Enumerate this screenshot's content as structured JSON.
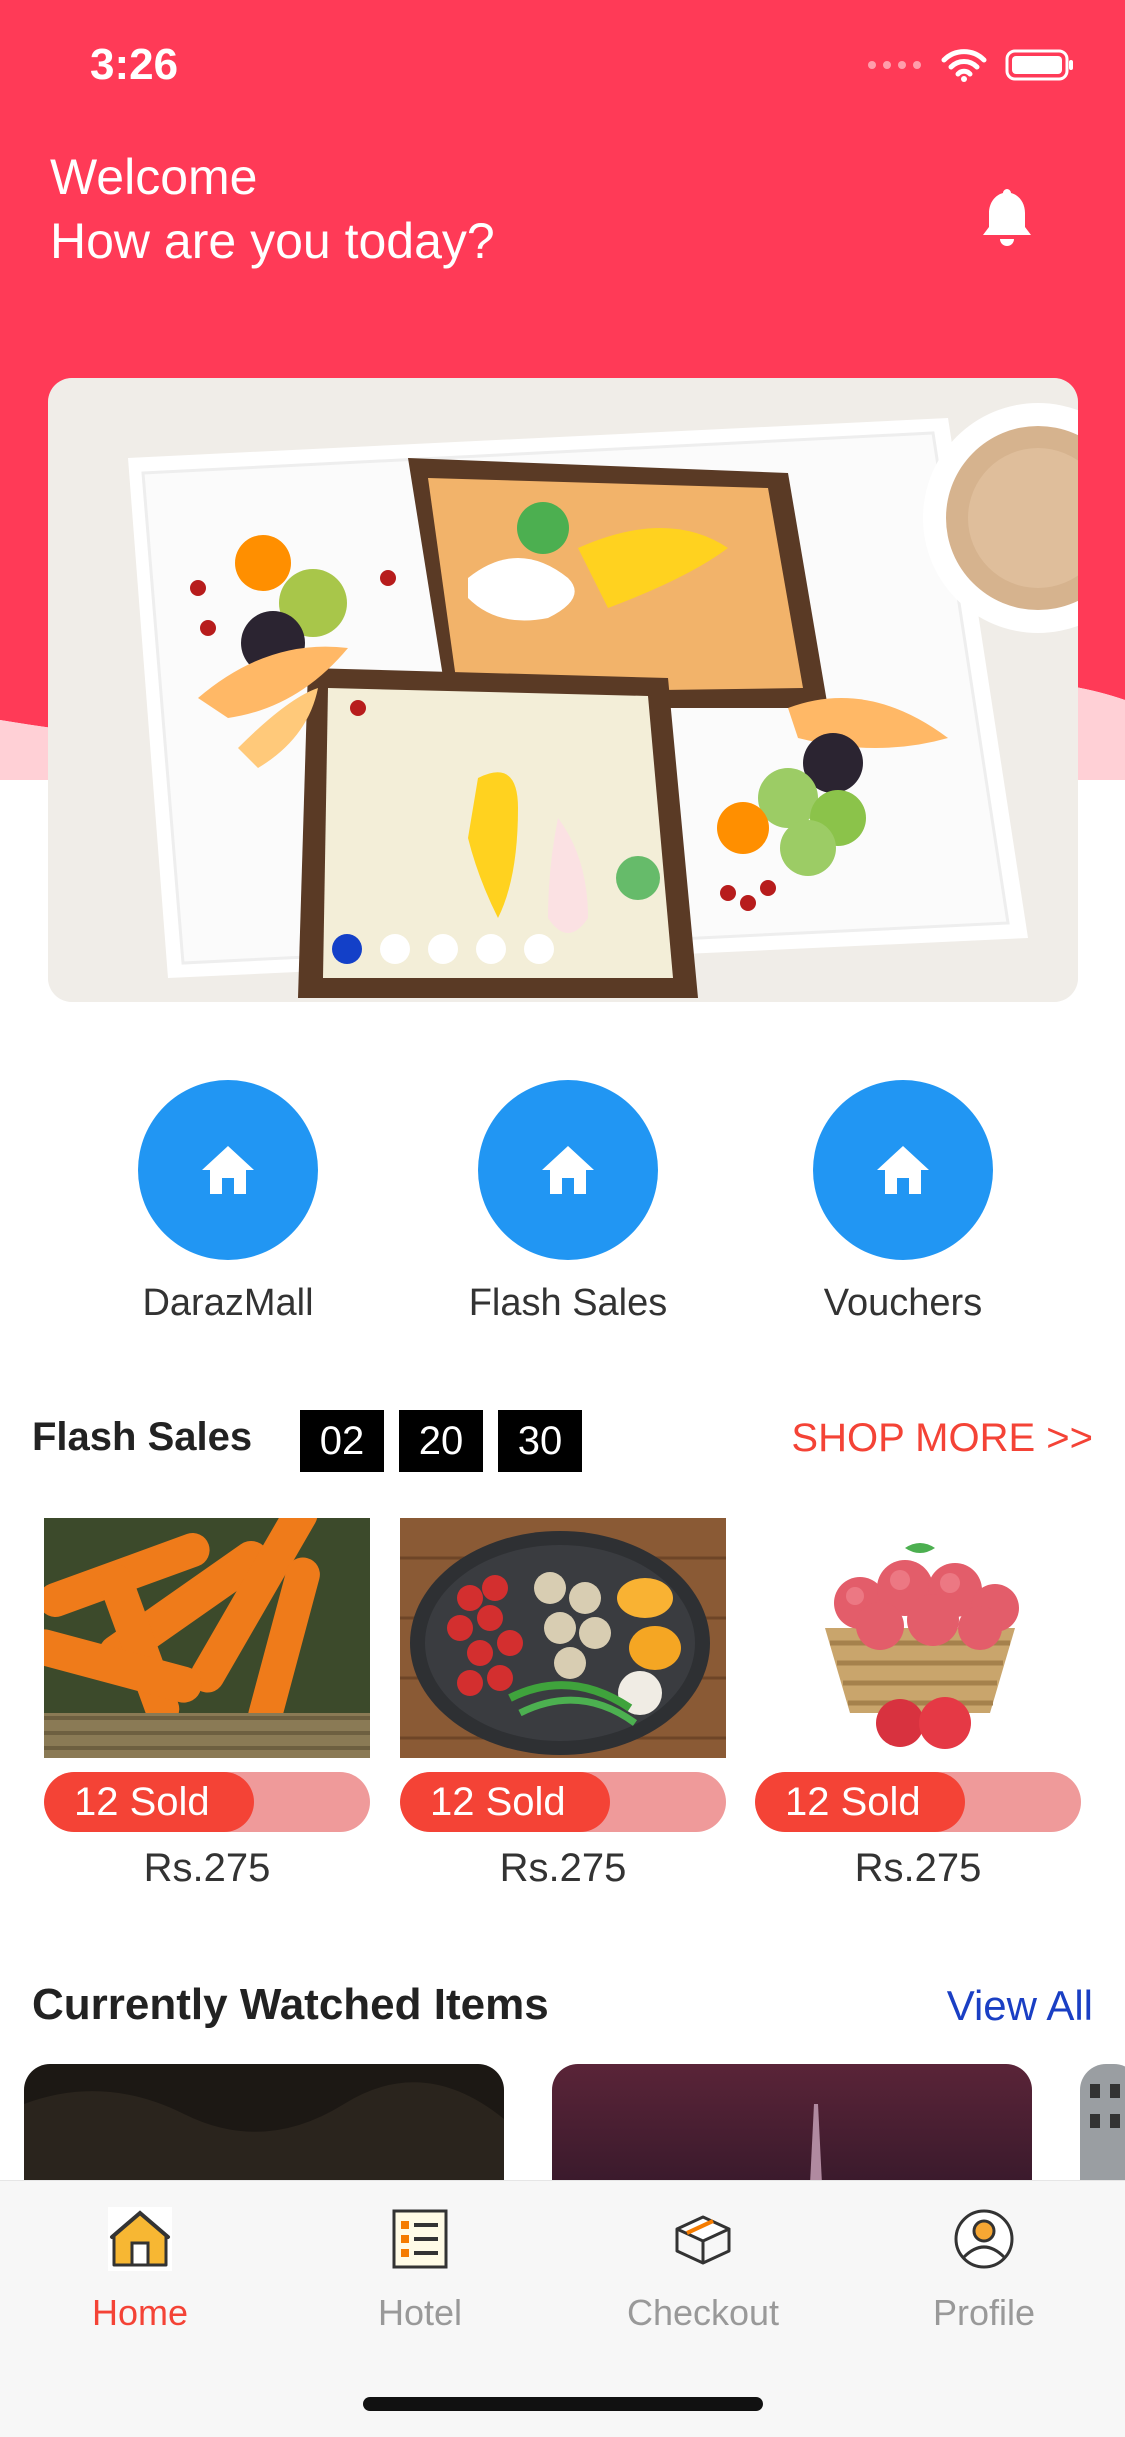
{
  "status_bar": {
    "time": "3:26"
  },
  "header": {
    "welcome": "Welcome",
    "subtitle": "How are you today?",
    "bell_icon": "bell-icon",
    "accent": "#ff3a57"
  },
  "banner": {
    "image": "breakfast-toast-plate",
    "dots": 5,
    "active_dot": 0
  },
  "categories": [
    {
      "label": "DarazMall",
      "icon": "home-icon"
    },
    {
      "label": "Flash Sales",
      "icon": "home-icon"
    },
    {
      "label": "Vouchers",
      "icon": "home-icon"
    }
  ],
  "flash_sales": {
    "title": "Flash Sales",
    "timer": [
      "02",
      "20",
      "30"
    ],
    "shop_more": "SHOP MORE >>",
    "products": [
      {
        "image": "carrots",
        "sold": "12 Sold",
        "price": "Rs.275"
      },
      {
        "image": "vegetable-bowl",
        "sold": "12 Sold",
        "price": "Rs.275"
      },
      {
        "image": "apple-basket",
        "sold": "12 Sold",
        "price": "Rs.275"
      }
    ]
  },
  "watched": {
    "title": "Currently Watched Items",
    "view_all": "View All"
  },
  "tabbar": {
    "tabs": [
      {
        "label": "Home",
        "icon": "home-icon",
        "active": true
      },
      {
        "label": "Hotel",
        "icon": "list-icon",
        "active": false
      },
      {
        "label": "Checkout",
        "icon": "box-icon",
        "active": false
      },
      {
        "label": "Profile",
        "icon": "user-icon",
        "active": false
      }
    ]
  }
}
